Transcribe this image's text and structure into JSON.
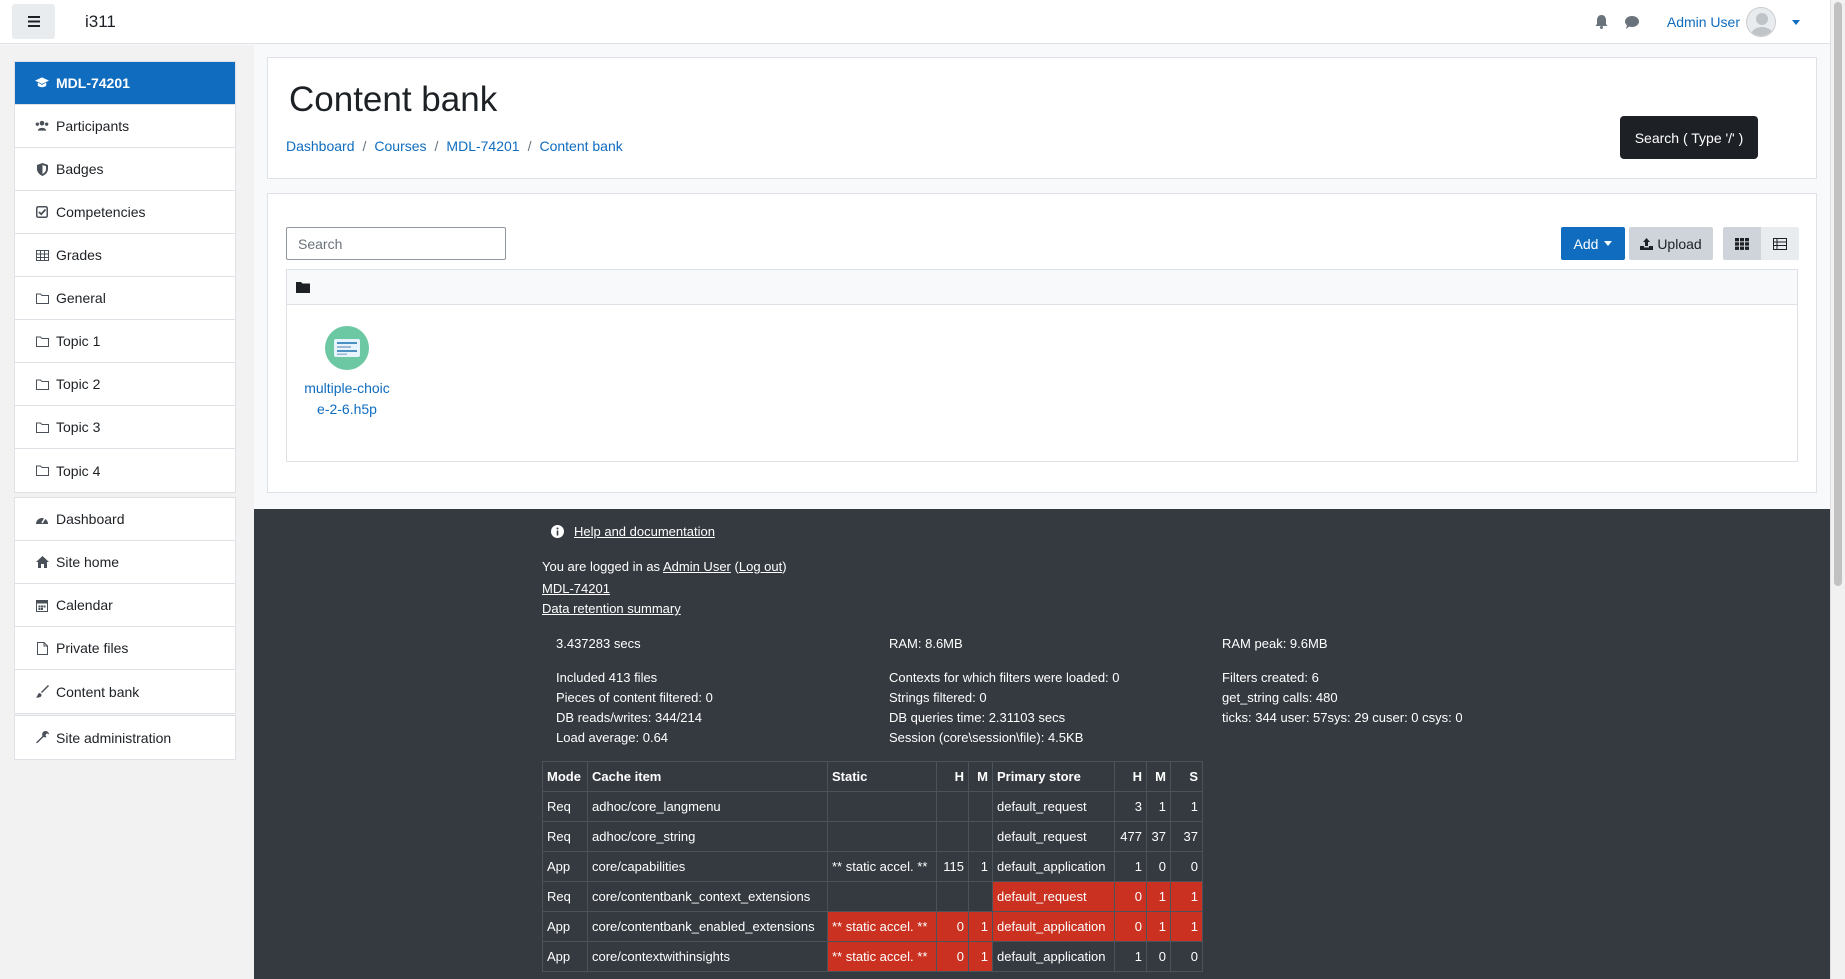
{
  "navbar": {
    "site_name": "i311",
    "user_name": "Admin User"
  },
  "drawer": {
    "course_items": [
      {
        "label": "MDL-74201",
        "icon": "graduation-cap-icon",
        "active": true
      },
      {
        "label": "Participants",
        "icon": "users-icon"
      },
      {
        "label": "Badges",
        "icon": "shield-icon"
      },
      {
        "label": "Competencies",
        "icon": "check-square-icon"
      },
      {
        "label": "Grades",
        "icon": "table-icon"
      },
      {
        "label": "General",
        "icon": "folder-icon"
      },
      {
        "label": "Topic 1",
        "icon": "folder-icon"
      },
      {
        "label": "Topic 2",
        "icon": "folder-icon"
      },
      {
        "label": "Topic 3",
        "icon": "folder-icon"
      },
      {
        "label": "Topic 4",
        "icon": "folder-icon"
      }
    ],
    "site_items": [
      {
        "label": "Dashboard",
        "icon": "tachometer-icon"
      },
      {
        "label": "Site home",
        "icon": "home-icon"
      },
      {
        "label": "Calendar",
        "icon": "calendar-icon"
      },
      {
        "label": "Private files",
        "icon": "file-icon"
      },
      {
        "label": "Content bank",
        "icon": "paint-brush-icon"
      }
    ],
    "admin_items": [
      {
        "label": "Site administration",
        "icon": "wrench-icon"
      }
    ]
  },
  "header": {
    "title": "Content bank",
    "breadcrumb": [
      "Dashboard",
      "Courses",
      "MDL-74201",
      "Content bank"
    ],
    "search_tooltip": "Search ( Type '/' )"
  },
  "contentbank": {
    "search_placeholder": "Search",
    "add_label": "Add",
    "upload_label": "Upload",
    "files": [
      {
        "name": "multiple-choice-2-6.h5p"
      }
    ]
  },
  "footer": {
    "help_link": "Help and documentation",
    "login_prefix": "You are logged in as",
    "login_user": "Admin User",
    "logout_link": "Log out",
    "links": [
      "MDL-74201",
      "Data retention summary"
    ],
    "perf": {
      "col1": [
        "3.437283 secs",
        "",
        "Included 413 files",
        "Pieces of content filtered: 0",
        "DB reads/writes: 344/214",
        "Load average: 0.64"
      ],
      "col2": [
        "RAM: 8.6MB",
        "",
        "Contexts for which filters were loaded: 0",
        "Strings filtered: 0",
        "DB queries time: 2.31103 secs",
        "Session (core\\session\\file): 4.5KB"
      ],
      "col3": [
        "RAM peak: 9.6MB",
        "",
        "Filters created: 6",
        "get_string calls: 480",
        "ticks: 344 user: 57sys: 29 cuser: 0 csys: 0"
      ]
    },
    "cache_table": {
      "headers": [
        "Mode",
        "Cache item",
        "Static",
        "H",
        "M",
        "Primary store",
        "H",
        "M",
        "S"
      ],
      "rows": [
        {
          "mode": "Req",
          "item": "adhoc/core_langmenu",
          "static": "",
          "sh": "",
          "sm": "",
          "store": "default_request",
          "h": "3",
          "m": "1",
          "s": "1",
          "red_static": false,
          "red_store": false
        },
        {
          "mode": "Req",
          "item": "adhoc/core_string",
          "static": "",
          "sh": "",
          "sm": "",
          "store": "default_request",
          "h": "477",
          "m": "37",
          "s": "37",
          "red_static": false,
          "red_store": false
        },
        {
          "mode": "App",
          "item": "core/capabilities",
          "static": "** static accel. **",
          "sh": "115",
          "sm": "1",
          "store": "default_application",
          "h": "1",
          "m": "0",
          "s": "0",
          "red_static": false,
          "red_store": false
        },
        {
          "mode": "Req",
          "item": "core/contentbank_context_extensions",
          "static": "",
          "sh": "",
          "sm": "",
          "store": "default_request",
          "h": "0",
          "m": "1",
          "s": "1",
          "red_static": false,
          "red_store": true
        },
        {
          "mode": "App",
          "item": "core/contentbank_enabled_extensions",
          "static": "** static accel. **",
          "sh": "0",
          "sm": "1",
          "store": "default_application",
          "h": "0",
          "m": "1",
          "s": "1",
          "red_static": true,
          "red_store": true
        },
        {
          "mode": "App",
          "item": "core/contextwithinsights",
          "static": "** static accel. **",
          "sh": "0",
          "sm": "1",
          "store": "default_application",
          "h": "1",
          "m": "0",
          "s": "0",
          "red_static": true,
          "red_store": false
        }
      ]
    }
  },
  "colors": {
    "primary": "#0f6cbf",
    "footer_bg": "#343a40",
    "miss_red": "#ca3120"
  }
}
